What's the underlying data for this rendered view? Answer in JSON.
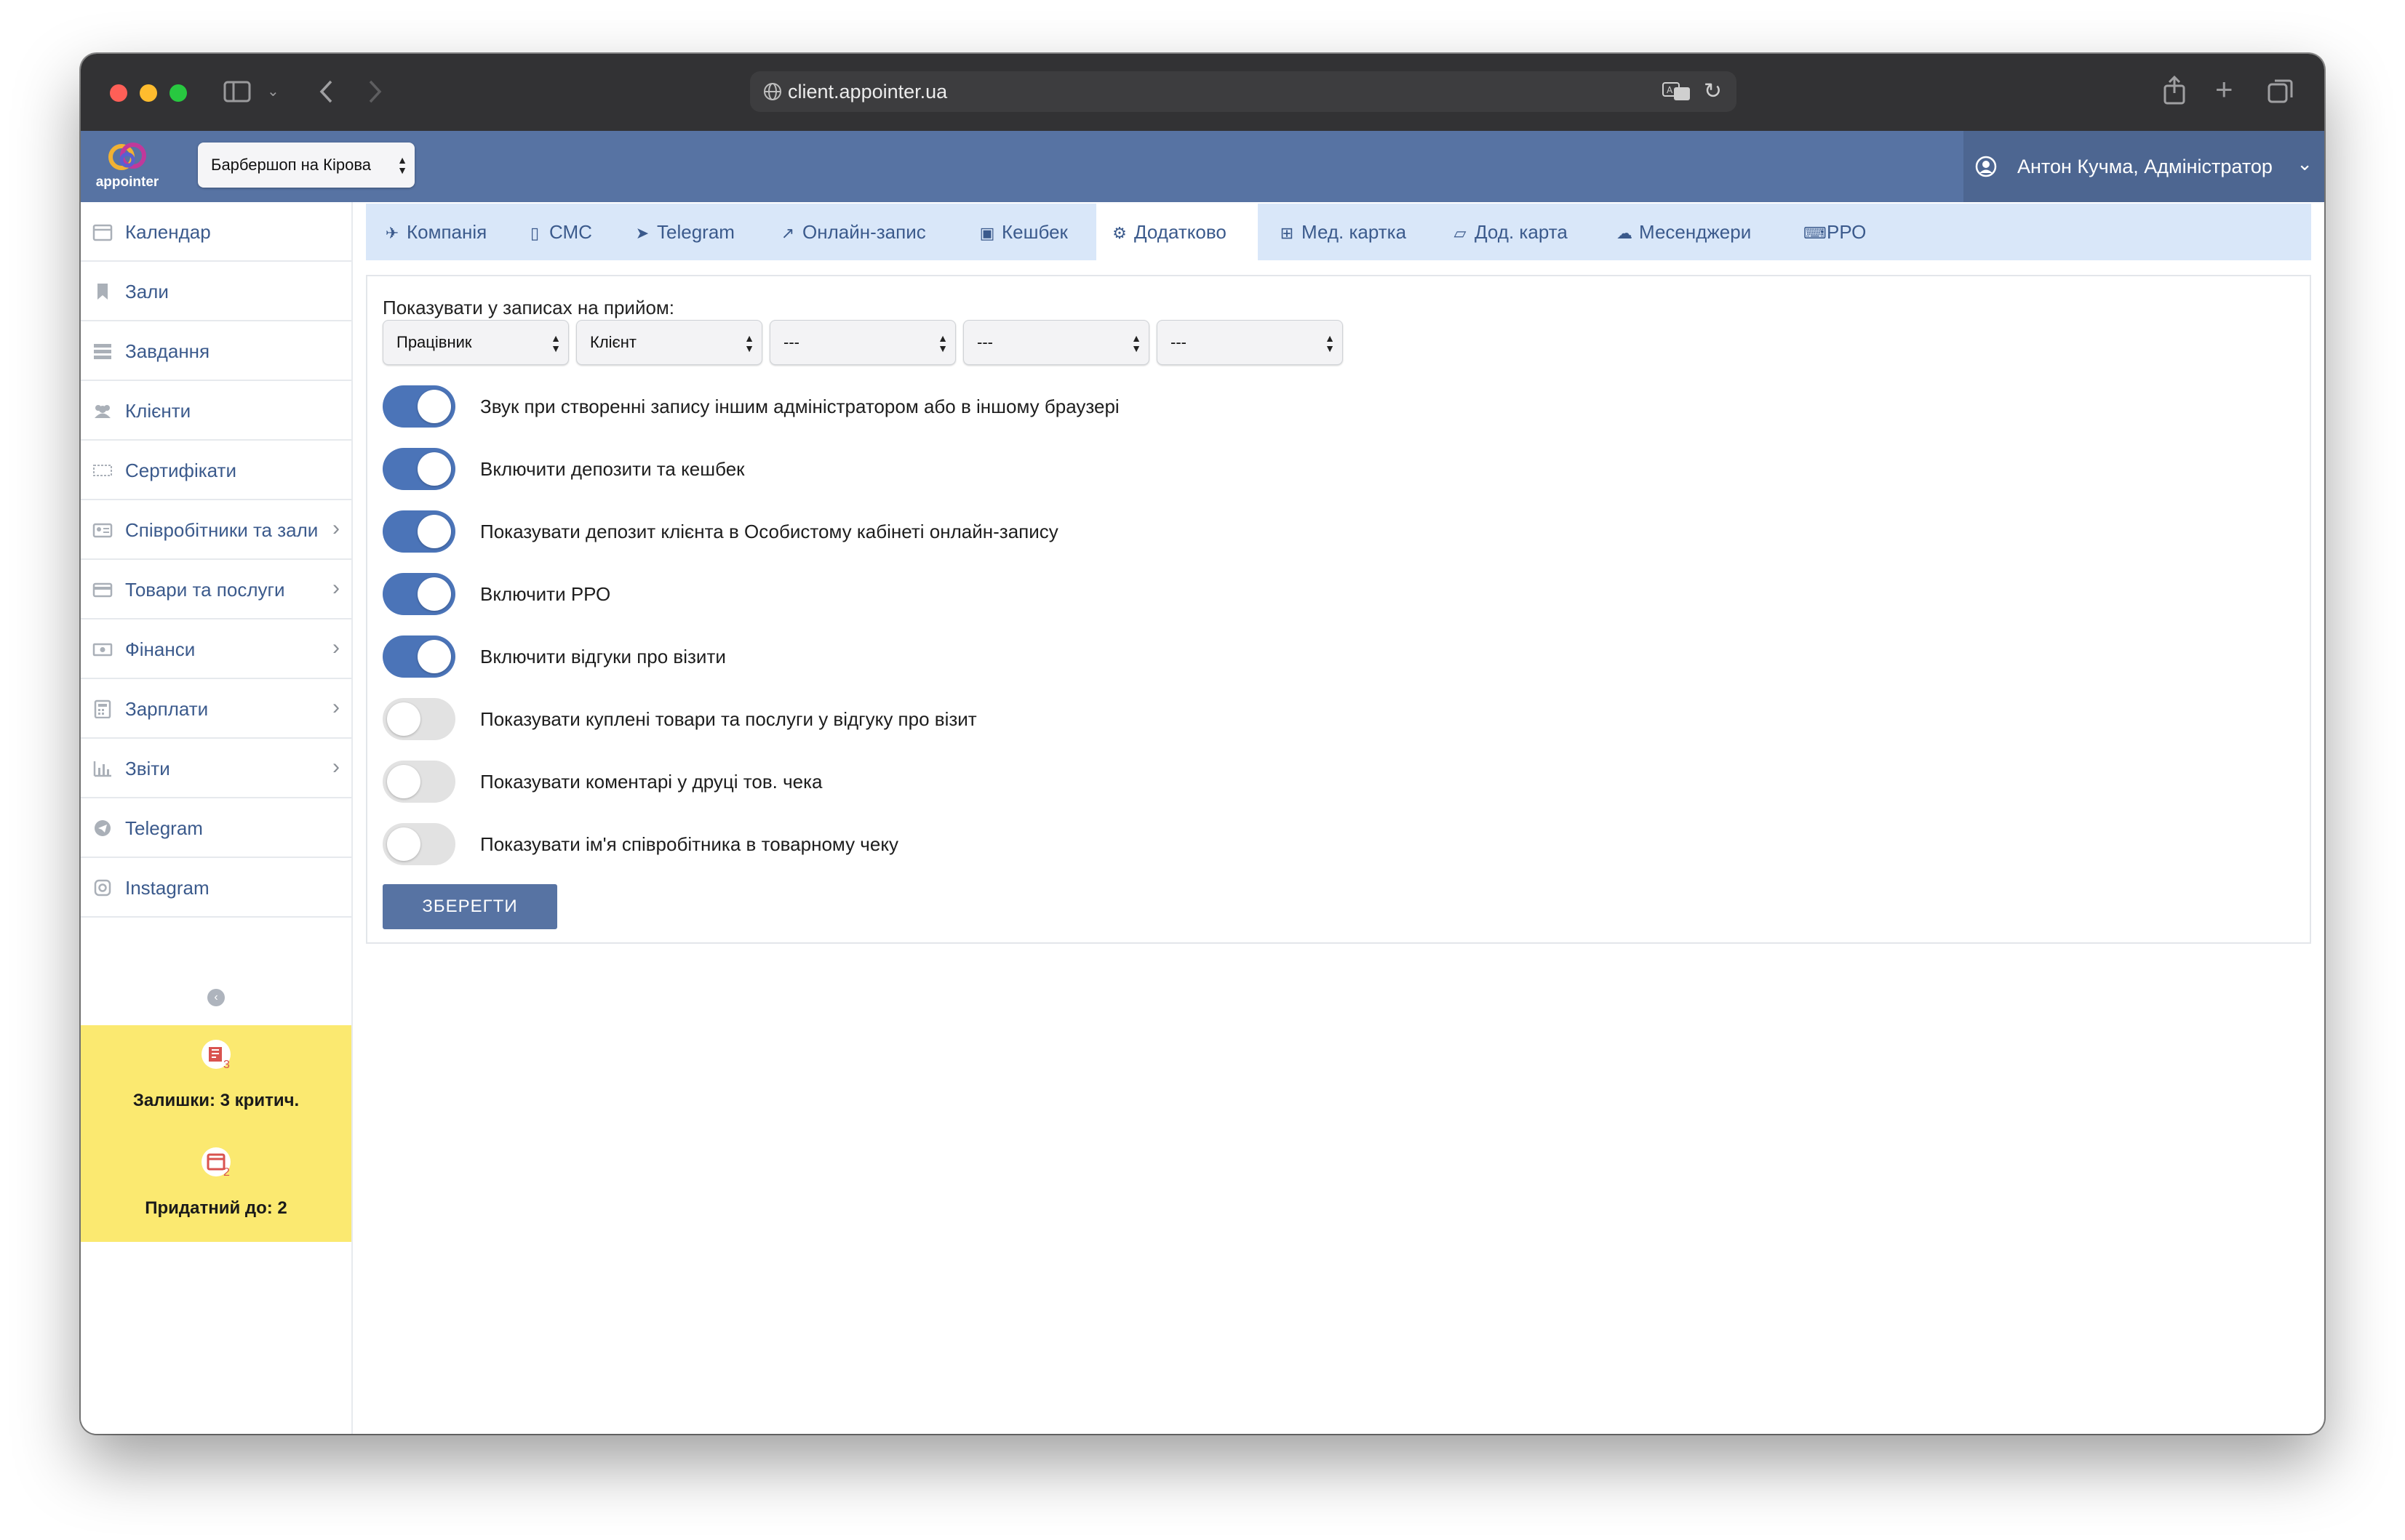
{
  "browser": {
    "url": "client.appointer.ua"
  },
  "header": {
    "logo_text": "appointer",
    "branch_select": "Барбершоп на Кірова",
    "user": "Антон Кучма, Адміністратор"
  },
  "sidebar": {
    "items": [
      {
        "label": "Календар",
        "icon": "calendar-icon",
        "chevron": false
      },
      {
        "label": "Зали",
        "icon": "bookmark-icon",
        "chevron": false
      },
      {
        "label": "Завдання",
        "icon": "tasks-icon",
        "chevron": false
      },
      {
        "label": "Клієнти",
        "icon": "users-icon",
        "chevron": false
      },
      {
        "label": "Сертифікати",
        "icon": "ticket-icon",
        "chevron": false
      },
      {
        "label": "Співробітники та зали",
        "icon": "id-card-icon",
        "chevron": true
      },
      {
        "label": "Товари та послуги",
        "icon": "credit-card-icon",
        "chevron": true
      },
      {
        "label": "Фінанси",
        "icon": "money-icon",
        "chevron": true
      },
      {
        "label": "Зарплати",
        "icon": "calculator-icon",
        "chevron": true
      },
      {
        "label": "Звіти",
        "icon": "bar-chart-icon",
        "chevron": true
      },
      {
        "label": "Telegram",
        "icon": "telegram-icon",
        "chevron": false
      },
      {
        "label": "Instagram",
        "icon": "instagram-icon",
        "chevron": false
      }
    ],
    "notices": [
      {
        "text": "Залишки: 3 критич.",
        "badge": "3",
        "icon": "inventory-alert-icon"
      },
      {
        "text": "Придатний до: 2",
        "badge": "2",
        "icon": "calendar-alert-icon"
      }
    ]
  },
  "tabs": [
    {
      "label": "Компанія",
      "icon": "rocket-icon",
      "glyph": "✈"
    },
    {
      "label": "СМС",
      "icon": "mobile-icon",
      "glyph": "▯"
    },
    {
      "label": "Telegram",
      "icon": "telegram-icon",
      "glyph": "➤"
    },
    {
      "label": "Онлайн-запис",
      "icon": "external-link-icon",
      "glyph": "↗"
    },
    {
      "label": "Кешбек",
      "icon": "money-icon",
      "glyph": "▣"
    },
    {
      "label": "Додатково",
      "icon": "cogs-icon",
      "glyph": "⚙",
      "active": true
    },
    {
      "label": "Мед. картка",
      "icon": "plus-square-icon",
      "glyph": "⊞"
    },
    {
      "label": "Дод. карта",
      "icon": "folder-open-icon",
      "glyph": "▱"
    },
    {
      "label": "Месенджери",
      "icon": "comments-icon",
      "glyph": "☁"
    },
    {
      "label": "РРО",
      "icon": "keyboard-icon",
      "glyph": "⌨"
    }
  ],
  "content": {
    "show_label": "Показувати у записах на прийом:",
    "selects": [
      "Працівник",
      "Клієнт",
      "---",
      "---",
      "---"
    ],
    "toggles": [
      {
        "label": "Звук при створенні запису іншим адміністратором або в іншому браузері",
        "on": true
      },
      {
        "label": "Включити депозити та кешбек",
        "on": true
      },
      {
        "label": "Показувати депозит клієнта в Особистому кабінеті онлайн-запису",
        "on": true
      },
      {
        "label": "Включити РРО",
        "on": true
      },
      {
        "label": "Включити відгуки про візити",
        "on": true
      },
      {
        "label": "Показувати куплені товари та послуги у відгуку про візит",
        "on": false
      },
      {
        "label": "Показувати коментарі у друці тов. чека",
        "on": false
      },
      {
        "label": "Показувати ім'я співробітника в товарному чеку",
        "on": false
      }
    ],
    "save_label": "ЗБЕРЕГТИ"
  },
  "colors": {
    "header": "#5773a3",
    "accent": "#4b74b8",
    "tabs_bg": "#d9e7f9",
    "notice_bg": "#fbe970",
    "link": "#3b5a8c"
  }
}
